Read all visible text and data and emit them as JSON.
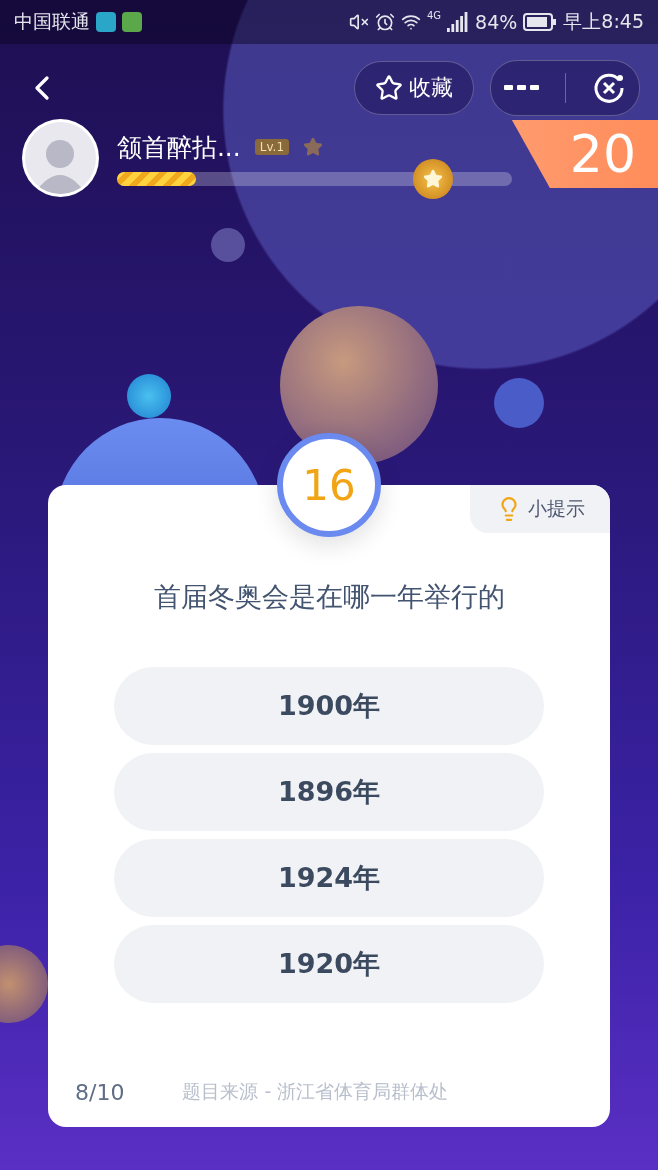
{
  "status_bar": {
    "carrier": "中国联通",
    "network": "4G",
    "battery": "84%",
    "time": "早上8:45"
  },
  "header": {
    "favorite_button": "收藏"
  },
  "profile": {
    "name": "颔首醉拈...",
    "level_badge": "Lv.1",
    "progress": {
      "level": 0.2
    }
  },
  "score": "20",
  "timer": "16",
  "hint_button": "小提示",
  "question": "首届冬奥会是在哪一年举行的",
  "options": [
    {
      "label": "1900年",
      "selected": false
    },
    {
      "label": "1896年",
      "selected": false
    },
    {
      "label": "1924年",
      "selected": false
    },
    {
      "label": "1920年",
      "selected": false
    }
  ],
  "footer": {
    "progress": "8/10",
    "source": "题目来源 - 浙江省体育局群体处"
  }
}
